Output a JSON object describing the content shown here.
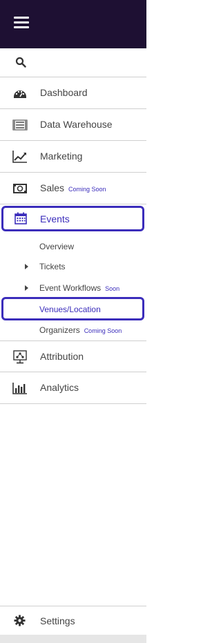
{
  "header": {
    "menu_icon": "hamburger-menu-icon"
  },
  "search": {
    "icon": "search-icon"
  },
  "nav": {
    "dashboard": {
      "label": "Dashboard",
      "icon": "dashboard-gauge-icon"
    },
    "data_warehouse": {
      "label": "Data Warehouse",
      "icon": "server-icon"
    },
    "marketing": {
      "label": "Marketing",
      "icon": "trend-line-chart-icon"
    },
    "sales": {
      "label": "Sales",
      "badge": "Coming Soon",
      "icon": "cash-icon"
    },
    "events": {
      "label": "Events",
      "icon": "calendar-icon",
      "submenu": {
        "overview": "Overview",
        "tickets": "Tickets",
        "event_workflows": "Event Workflows",
        "event_workflows_badge": "Soon",
        "venues": "Venues/Location",
        "organizers": "Organizers",
        "organizers_badge": "Coming Soon"
      }
    },
    "attribution": {
      "label": "Attribution",
      "icon": "attribution-network-icon"
    },
    "analytics": {
      "label": "Analytics",
      "icon": "bar-chart-icon"
    }
  },
  "settings": {
    "label": "Settings",
    "icon": "gear-icon"
  },
  "colors": {
    "header_bg": "#1e1033",
    "accent": "#3b2dbb",
    "text": "#444444",
    "divider": "#cfcfcf"
  }
}
